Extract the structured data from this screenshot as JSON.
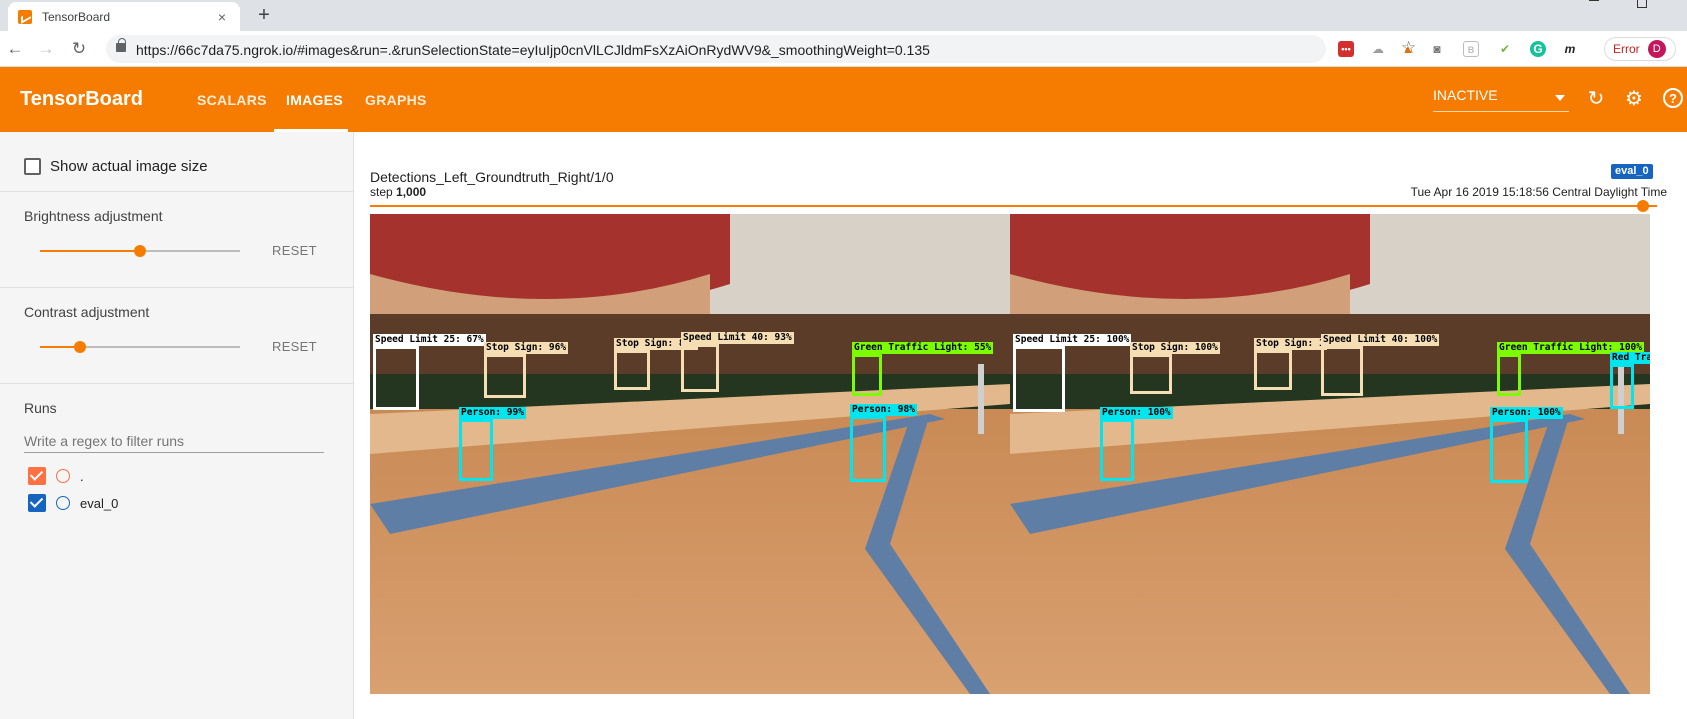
{
  "browser": {
    "tab_title": "TensorBoard",
    "tab_close": "×",
    "new_tab": "+",
    "url": "https://66c7da75.ngrok.io/#images&run=.&runSelectionState=eyIuIjp0cnVlLCJldmFsXzAiOnRydWV9&_smoothingWeight=0.135",
    "error_label": "Error",
    "avatar_letter": "D"
  },
  "header": {
    "title": "TensorBoard",
    "tabs": [
      {
        "label": "SCALARS"
      },
      {
        "label": "IMAGES",
        "active": true
      },
      {
        "label": "GRAPHS"
      }
    ],
    "status_select": "INACTIVE"
  },
  "sidebar": {
    "show_actual_size": "Show actual image size",
    "brightness": {
      "label": "Brightness adjustment",
      "value": 0.5,
      "reset": "RESET"
    },
    "contrast": {
      "label": "Contrast adjustment",
      "value": 0.2,
      "reset": "RESET"
    },
    "runs": {
      "heading": "Runs",
      "filter_placeholder": "Write a regex to filter runs",
      "items": [
        {
          "label": ".",
          "color": "#ff7043",
          "checked": true
        },
        {
          "label": "eval_0",
          "color": "#1565c0",
          "checked": true
        }
      ]
    }
  },
  "card": {
    "title": "Detections_Left_Groundtruth_Right/1/0",
    "step_prefix": "step",
    "step": "1,000",
    "run": "eval_0",
    "timestamp": "Tue Apr 16 2019 15:18:56 Central Daylight Time",
    "detections_left": [
      "Speed Limit 25: 67%",
      "Stop Sign: 96%",
      "Stop Sign: 83%",
      "Speed Limit 40: 93%",
      "Green Traffic Light: 55%",
      "Person: 99%",
      "Person: 98%"
    ],
    "groundtruth_right": [
      "Speed Limit 25: 100%",
      "Stop Sign: 100%",
      "Stop Sign: 1",
      "Speed Limit 40: 100%",
      "Green Traffic Light: 100%",
      "Red Tra",
      "Person: 100%",
      "Person: 100%"
    ]
  },
  "colors": {
    "accent": "#f57c00",
    "person_box": "#00e5ee",
    "light_box": "#7cfc00",
    "sign_box": "#f5deb3",
    "speed_box": "#ffffff"
  }
}
